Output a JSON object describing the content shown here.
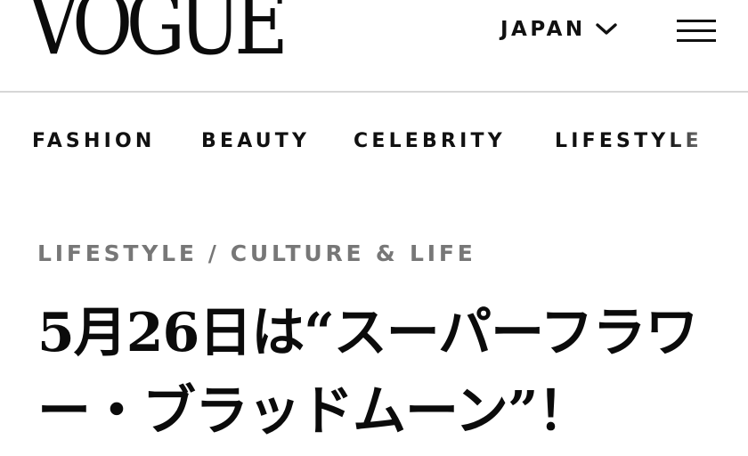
{
  "header": {
    "logo_text": "VOGUE",
    "edition_label": "JAPAN",
    "edition_icon": "chevron-down-icon",
    "menu_icon": "hamburger-menu-icon"
  },
  "nav": {
    "items": [
      {
        "label": "FASHION"
      },
      {
        "label": "BEAUTY"
      },
      {
        "label": "CELEBRITY"
      },
      {
        "label": "LIFESTYLE"
      }
    ]
  },
  "article": {
    "breadcrumb": {
      "section": "LIFESTYLE",
      "separator": "/",
      "subsection": "CULTURE & LIFE"
    },
    "headline": "5月26日は“スーパーフラワー・ブラッドムーン”！"
  }
}
